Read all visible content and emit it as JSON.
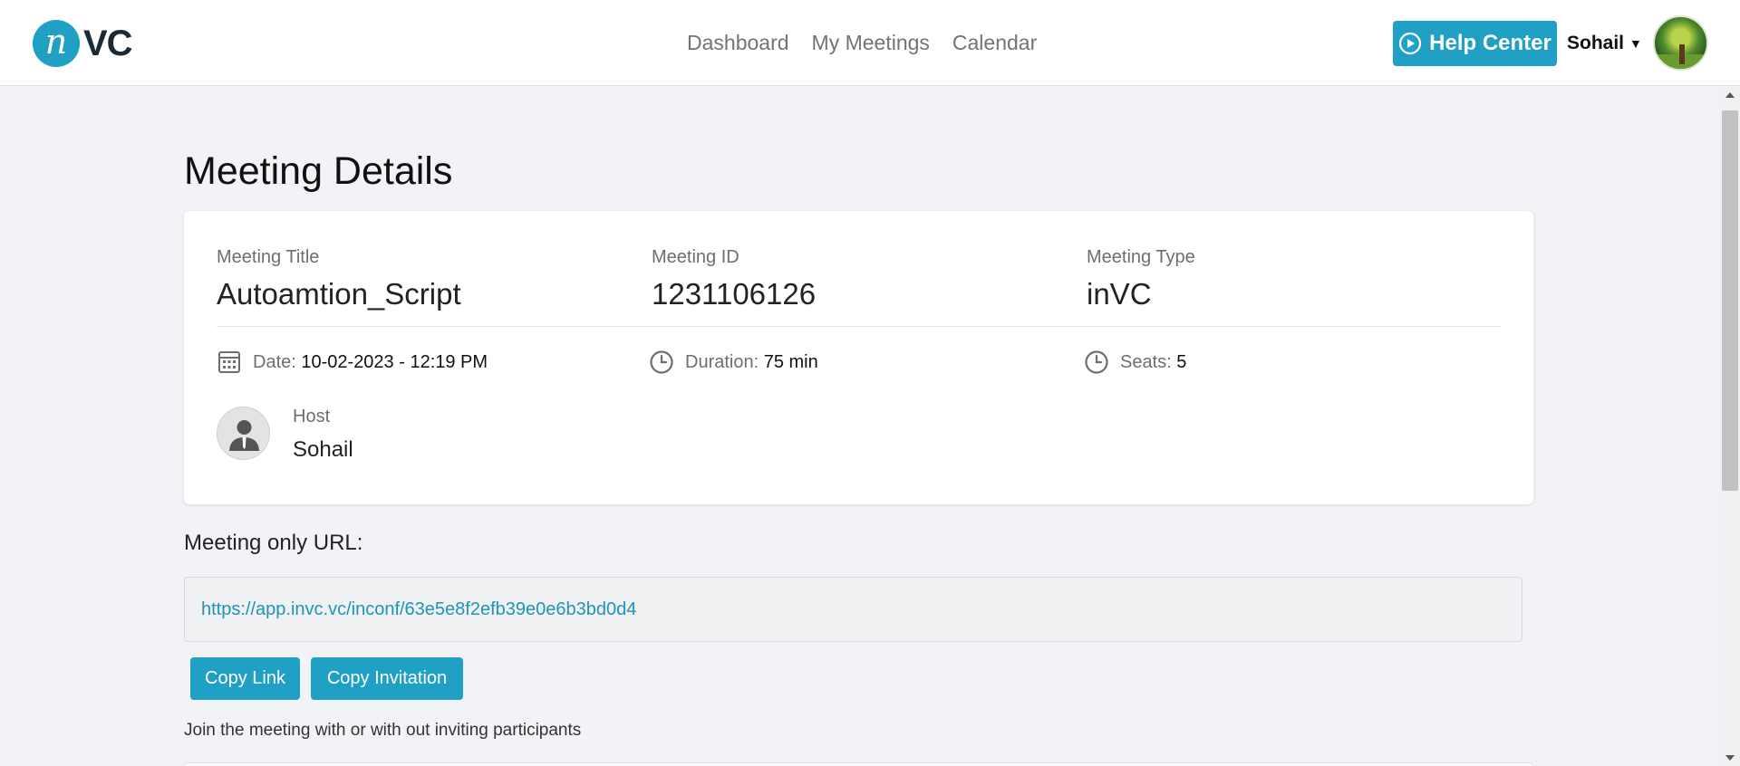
{
  "header": {
    "logo_mark": "n",
    "logo_text": "VC",
    "nav": [
      "Dashboard",
      "My Meetings",
      "Calendar"
    ],
    "help_label": "Help Center",
    "user_name": "Sohail",
    "caret": "▼"
  },
  "page": {
    "title": "Meeting Details"
  },
  "meeting": {
    "title_label": "Meeting Title",
    "title_value": "Autoamtion_Script",
    "id_label": "Meeting ID",
    "id_value": "1231106126",
    "type_label": "Meeting Type",
    "type_value": "inVC",
    "date_label": "Date:",
    "date_value": "10-02-2023 - 12:19 PM",
    "duration_label": "Duration:",
    "duration_value": "75 min",
    "seats_label": "Seats:",
    "seats_value": "5",
    "host_label": "Host",
    "host_name": "Sohail"
  },
  "url_section": {
    "label": "Meeting only URL:",
    "url": "https://app.invc.vc/inconf/63e5e8f2efb39e0e6b3bd0d4",
    "copy_link": "Copy Link",
    "copy_invitation": "Copy Invitation",
    "hint": "Join the meeting with or with out inviting participants"
  },
  "icons": {
    "help": "play-circle-icon",
    "date": "calendar-icon",
    "duration": "clock-icon",
    "seats": "clock-icon",
    "host": "user-avatar-icon"
  },
  "colors": {
    "accent": "#1fa0c4",
    "link": "#1f94b8",
    "background": "#f2f3f6"
  }
}
